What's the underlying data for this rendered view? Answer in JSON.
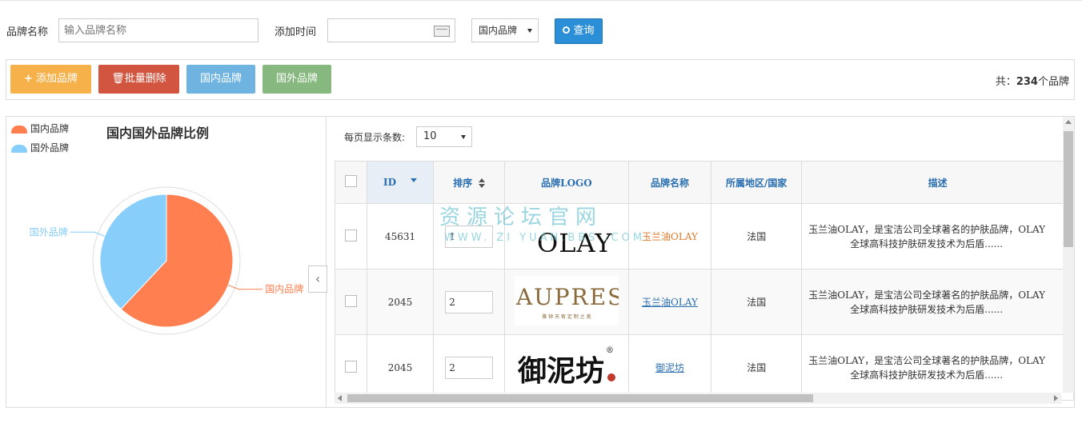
{
  "search": {
    "brand_name_label": "品牌名称",
    "brand_name_placeholder": "输入品牌名称",
    "add_time_label": "添加时间",
    "region_select": "国内品牌",
    "query_button": "查询"
  },
  "toolbar": {
    "add_brand": "添加品牌",
    "batch_delete": "批量删除",
    "domestic": "国内品牌",
    "foreign": "国外品牌",
    "total_prefix": "共：",
    "total_count": "234",
    "total_suffix": "个品牌"
  },
  "colors": {
    "add": "#f6b14b",
    "delete": "#d2553f",
    "domestic": "#6fb3e0",
    "foreign": "#87b87f",
    "pie_domestic": "#ff7f50",
    "pie_foreign": "#87cefa"
  },
  "chart_data": {
    "type": "pie",
    "title": "国内国外品牌比例",
    "legend": [
      "国内品牌",
      "国外品牌"
    ],
    "series": [
      {
        "name": "国内品牌",
        "value": 62
      },
      {
        "name": "国外品牌",
        "value": 38
      }
    ],
    "slice_labels": [
      "国内品牌",
      "国外品牌"
    ]
  },
  "collapse_icon": "‹",
  "table": {
    "page_size_label": "每页显示条数:",
    "page_size_value": "10",
    "headers": [
      "ID",
      "排序",
      "品牌LOGO",
      "品牌名称",
      "所属地区/国家",
      "描述"
    ],
    "rows": [
      {
        "id": "45631",
        "order": "1",
        "logo": "OLAY",
        "name": "玉兰油OLAY",
        "region": "法国",
        "desc1": "玉兰油OLAY，是宝洁公司全球著名的护肤品牌，OLAY",
        "desc2": "全球高科技护肤研发技术为后盾......"
      },
      {
        "id": "2045",
        "order": "2",
        "logo": "AUPRES",
        "logo_sub": "雅 钟 天 宥   定 制 之 美",
        "name": "玉兰油OLAY",
        "region": "法国",
        "desc1": "玉兰油OLAY，是宝洁公司全球著名的护肤品牌，OLAY",
        "desc2": "全球高科技护肤研发技术为后盾......"
      },
      {
        "id": "2045",
        "order": "2",
        "logo": "御泥坊",
        "logo_mark": "®",
        "name": "御泥坊",
        "region": "法国",
        "desc1": "玉兰油OLAY，是宝洁公司全球著名的护肤品牌，OLAY",
        "desc2": "全球高科技护肤研发技术为后盾......"
      }
    ]
  },
  "watermark": {
    "line1": "资源论坛官网",
    "line2": "WWW. ZI YUAN.BBS .COM"
  }
}
